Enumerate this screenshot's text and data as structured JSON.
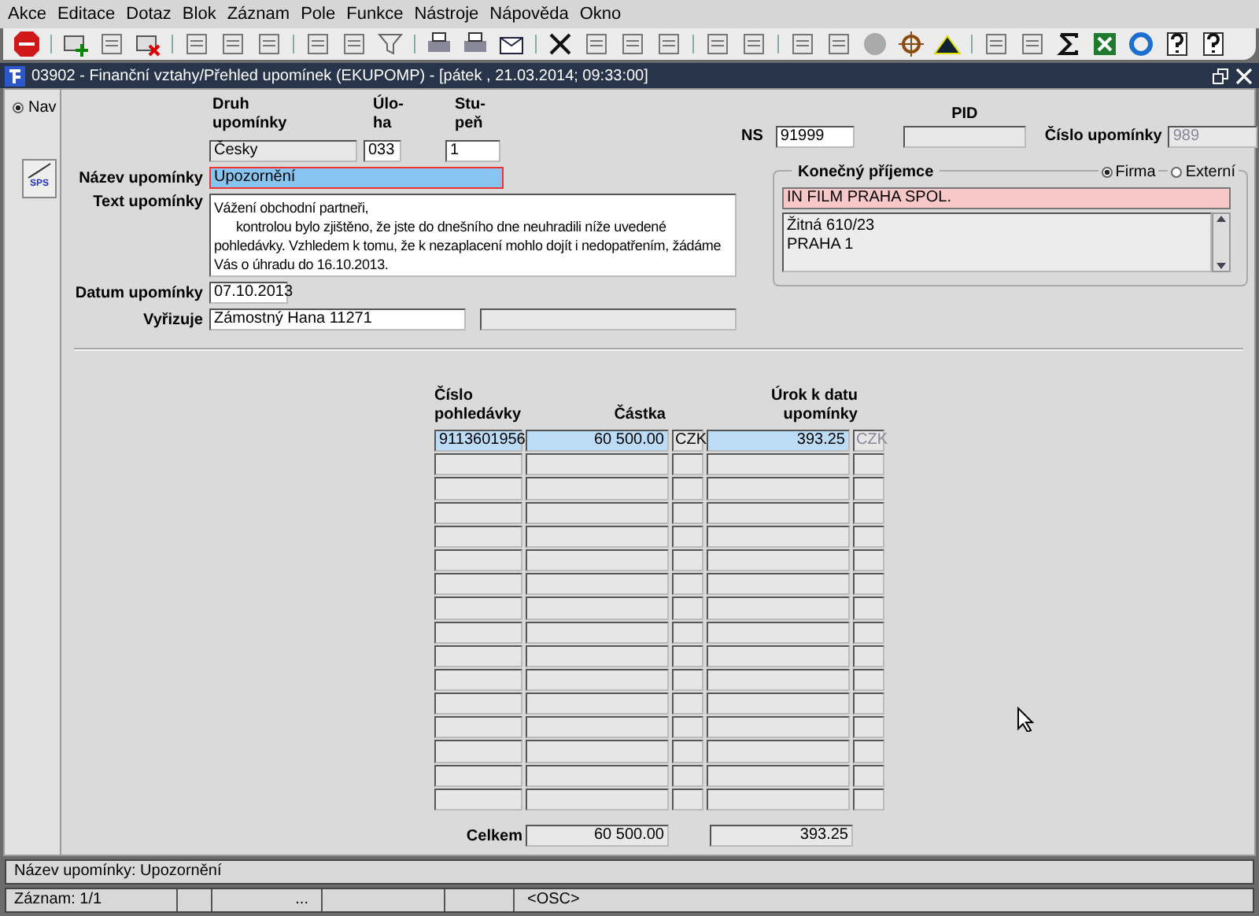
{
  "menu": [
    "Akce",
    "Editace",
    "Dotaz",
    "Blok",
    "Záznam",
    "Pole",
    "Funkce",
    "Nástroje",
    "Nápověda",
    "Okno"
  ],
  "window": {
    "title": "03902 - Finanční vztahy/Přehled upomínek (EKUPOMP) - [pátek  , 21.03.2014; 09:33:00]"
  },
  "side": {
    "nav": {
      "label": "Nav",
      "selected": true
    },
    "sps_button": "SPS"
  },
  "form": {
    "druh": {
      "label": [
        "Druh",
        "upomínky"
      ],
      "value": "Česky"
    },
    "uloha": {
      "label": [
        "Úlo-",
        "ha"
      ],
      "value": "033"
    },
    "stupen": {
      "label": [
        "Stu-",
        "peň"
      ],
      "value": "1"
    },
    "nazev": {
      "label": "Název upomínky",
      "value": "Upozornění"
    },
    "text": {
      "label": "Text upomínky",
      "lines": [
        "Vážení obchodní partneři,",
        "kontrolou bylo zjištěno, že jste do dnešního dne neuhradili níže uvedené",
        "pohledávky. Vzhledem k tomu, že k nezaplacení mohlo dojít i nedopatřením, žádáme",
        "Vás o úhradu do 16.10.2013."
      ]
    },
    "datum": {
      "label": "Datum upomínky",
      "value": "07.10.2013"
    },
    "vyrizuje": {
      "label": "Vyřizuje",
      "value": "Zámostný Hana 11271"
    },
    "ns": {
      "label": "NS",
      "value": "91999"
    },
    "pid": {
      "label": "PID"
    },
    "cislo": {
      "label": "Číslo upomínky",
      "value": "989"
    }
  },
  "recipient": {
    "title": "Konečný příjemce",
    "options": [
      {
        "label": "Firma",
        "selected": true
      },
      {
        "label": "Externí",
        "selected": false
      }
    ],
    "name": "IN FILM PRAHA SPOL.",
    "address": [
      "Žitná 610/23",
      "PRAHA 1"
    ]
  },
  "table": {
    "columns": [
      "Číslo pohledávky",
      "Částka",
      "Úrok k datu upomínky"
    ],
    "rows": [
      {
        "cislo": "9113601956",
        "castka": "60 500.00",
        "mena": "CZK",
        "urok": "393.25",
        "mena2": "CZK",
        "selected": true
      }
    ],
    "total": {
      "label": "Celkem",
      "castka": "60 500.00",
      "urok": "393.25"
    }
  },
  "status": {
    "message": "Název upomínky: Upozornění",
    "record": "Záznam: 1/1",
    "segment_3": "...",
    "segment_6": "<OSC>"
  }
}
